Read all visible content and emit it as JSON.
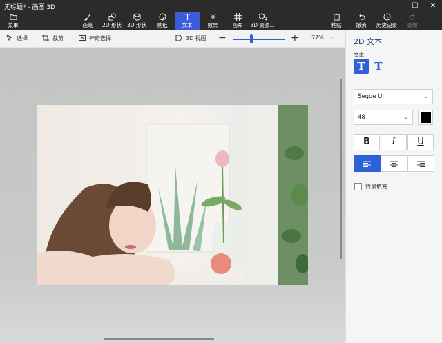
{
  "window": {
    "title": "无标题* - 画图 3D",
    "controls": [
      "minimize",
      "maximize",
      "close"
    ]
  },
  "ribbon": {
    "menu": {
      "label": "菜单",
      "icon": "folder-icon"
    },
    "tools": [
      {
        "label": "画笔",
        "icon": "brush-icon"
      },
      {
        "label": "2D 形状",
        "icon": "shapes-2d-icon"
      },
      {
        "label": "3D 形状",
        "icon": "cube-icon"
      },
      {
        "label": "贴纸",
        "icon": "sticker-icon"
      },
      {
        "label": "文本",
        "icon": "text-icon",
        "active": true
      },
      {
        "label": "效果",
        "icon": "effects-sun-icon"
      },
      {
        "label": "画布",
        "icon": "canvas-grid-icon"
      },
      {
        "label": "3D 资源...",
        "icon": "library-icon"
      }
    ],
    "right_tools": [
      {
        "label": "粘贴",
        "icon": "paste-icon"
      },
      {
        "label": "撤消",
        "icon": "undo-icon"
      },
      {
        "label": "历史记录",
        "icon": "history-icon"
      },
      {
        "label": "重做",
        "icon": "redo-icon",
        "disabled": true
      }
    ]
  },
  "subbar": {
    "select": "选择",
    "crop": "裁剪",
    "magic_select": "神奇选择",
    "view_3d": "3D 视图",
    "zoom_out": "−",
    "zoom_in": "+",
    "zoom": "77%",
    "more": "···"
  },
  "panel": {
    "title": "2D 文本",
    "text_section": "文本",
    "text_type_plain": "T",
    "text_type_3d": "T",
    "font": "Segoe UI",
    "size": "48",
    "color": "#000000",
    "bold": "B",
    "italic": "I",
    "underline": "U",
    "bg_fill": "背景填充"
  }
}
